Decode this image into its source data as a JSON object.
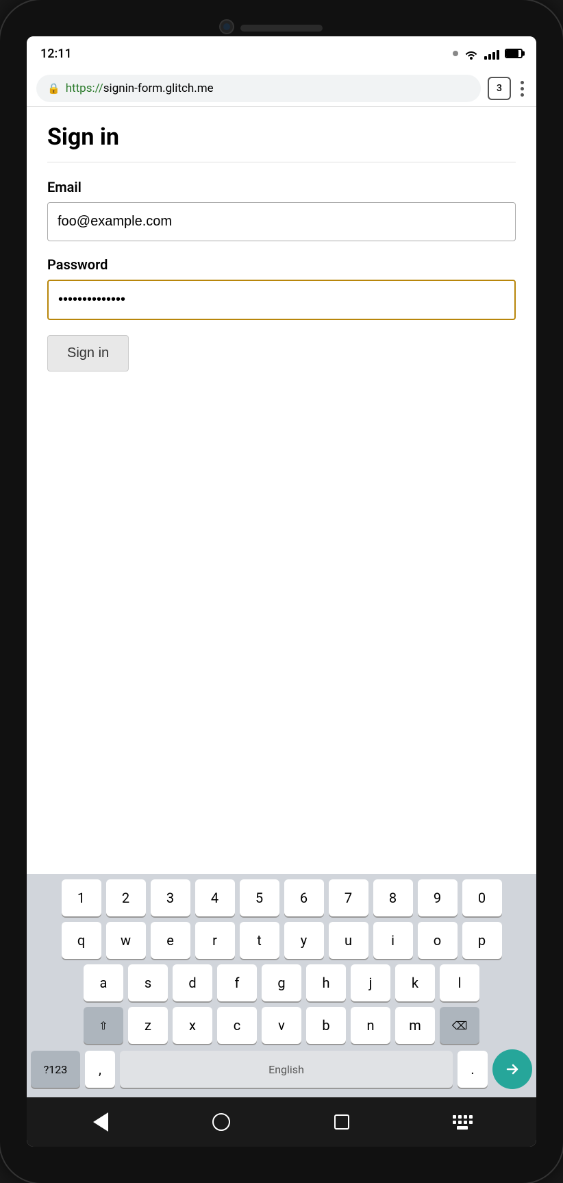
{
  "phone": {
    "status_bar": {
      "time": "12:11",
      "tab_count": "3"
    },
    "address_bar": {
      "protocol": "https://",
      "domain": "signin-form.glitch.me",
      "full_url": "https://signin-form.glitch.me",
      "menu_label": "⋮"
    },
    "page": {
      "title": "Sign in",
      "email_label": "Email",
      "email_value": "foo@example.com",
      "password_label": "Password",
      "password_value": "••••••••••••",
      "submit_label": "Sign in"
    },
    "keyboard": {
      "row1": [
        "1",
        "2",
        "3",
        "4",
        "5",
        "6",
        "7",
        "8",
        "9",
        "0"
      ],
      "row2": [
        "q",
        "w",
        "e",
        "r",
        "t",
        "y",
        "u",
        "i",
        "o",
        "p"
      ],
      "row3": [
        "a",
        "s",
        "d",
        "f",
        "g",
        "h",
        "j",
        "k",
        "l"
      ],
      "row4": [
        "z",
        "x",
        "c",
        "v",
        "b",
        "n",
        "m"
      ],
      "special_left": "?123",
      "comma": ",",
      "spacebar_label": "English",
      "period": ".",
      "backspace": "⌫",
      "shift": "⇧",
      "enter_arrow": "→"
    }
  }
}
